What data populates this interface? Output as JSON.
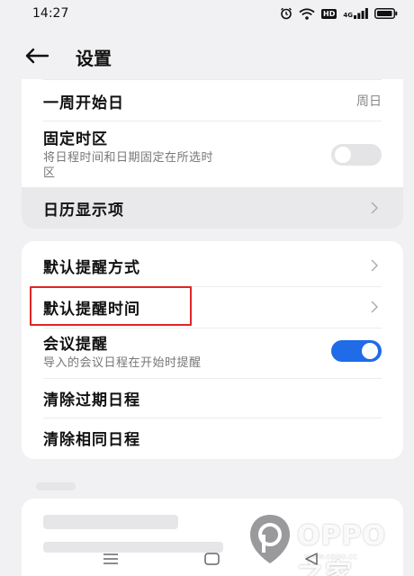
{
  "status_bar": {
    "time": "14:27",
    "icons": [
      "alarm-icon",
      "wifi-icon",
      "hd-icon",
      "cellular-signal-icon",
      "battery-icon"
    ],
    "hd_label": "HD",
    "signal_label": "4G"
  },
  "header": {
    "back_icon": "arrow-left-icon",
    "title": "设置"
  },
  "card1": {
    "week_start": {
      "label": "一周开始日",
      "value": "周日"
    },
    "fixed_timezone": {
      "label": "固定时区",
      "sub_line1": "将日程时间和日期固定在所选时",
      "sub_line2": "区",
      "enabled": false
    },
    "calendar_display": {
      "label": "日历显示项"
    }
  },
  "card2": {
    "default_reminder_method": {
      "label": "默认提醒方式"
    },
    "default_reminder_time": {
      "label": "默认提醒时间"
    },
    "meeting_reminder": {
      "label": "会议提醒",
      "sub": "导入的会议日程在开始时提醒",
      "enabled": true
    },
    "clear_expired": {
      "label": "清除过期日程"
    },
    "clear_duplicate": {
      "label": "清除相同日程"
    }
  },
  "colors": {
    "accent": "#1f6be8",
    "highlight": "#e02525",
    "background": "#f1f1f3",
    "card": "#ffffff"
  },
  "watermark": {
    "text": "OPPO之家",
    "url": "www.oppo.cc"
  },
  "nav_bar": {
    "icons": [
      "menu-icon",
      "home-icon",
      "back-icon"
    ]
  }
}
